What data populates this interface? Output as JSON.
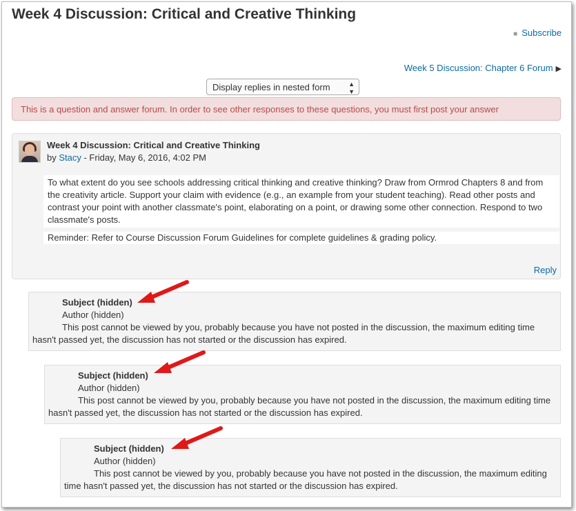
{
  "page": {
    "title": "Week 4 Discussion: Critical and Creative Thinking",
    "subscribe_label": "Subscribe",
    "next_discussion_label": "Week 5 Discussion: Chapter 6 Forum",
    "display_mode_selected": "Display replies in nested form",
    "alert": "This is a question and answer forum. In order to see other responses to these questions, you must first post your answer"
  },
  "main_post": {
    "subject": "Week 4 Discussion: Critical and Creative Thinking",
    "by": "by",
    "author": "Stacy",
    "date": " - Friday, May 6, 2016, 4:02 PM",
    "body": "To what extent do you see schools addressing critical thinking and creative thinking?  Draw from Ormrod Chapters 8 and from the creativity article.  Support your claim with evidence (e.g., an example from your student teaching).  Read other posts and contrast your point with another classmate's point, elaborating on a point, or drawing some other connection.  Respond to two classmate's posts.",
    "reminder": "Reminder: Refer to Course Discussion Forum Guidelines  for complete guidelines & grading policy.",
    "reply_label": "Reply"
  },
  "hidden_posts": [
    {
      "subject": "Subject (hidden)",
      "author": "Author (hidden)",
      "body": "This post cannot be viewed by you, probably because you have not posted in the discussion, the maximum editing time hasn't passed yet, the discussion has not started or the discussion has expired."
    },
    {
      "subject": "Subject (hidden)",
      "author": "Author (hidden)",
      "body": "This post cannot be viewed by you, probably because you have not posted in the discussion, the maximum editing time hasn't passed yet, the discussion has not started or the discussion has expired."
    },
    {
      "subject": "Subject (hidden)",
      "author": "Author (hidden)",
      "body": "This post cannot be viewed by you, probably because you have not posted in the discussion, the maximum editing time hasn't passed yet, the discussion has not started or the discussion has expired."
    }
  ],
  "colors": {
    "link": "#0a6aa1",
    "alert_bg": "#f2dede",
    "alert_text": "#b94a48",
    "annotation_arrow": "#e01818"
  }
}
